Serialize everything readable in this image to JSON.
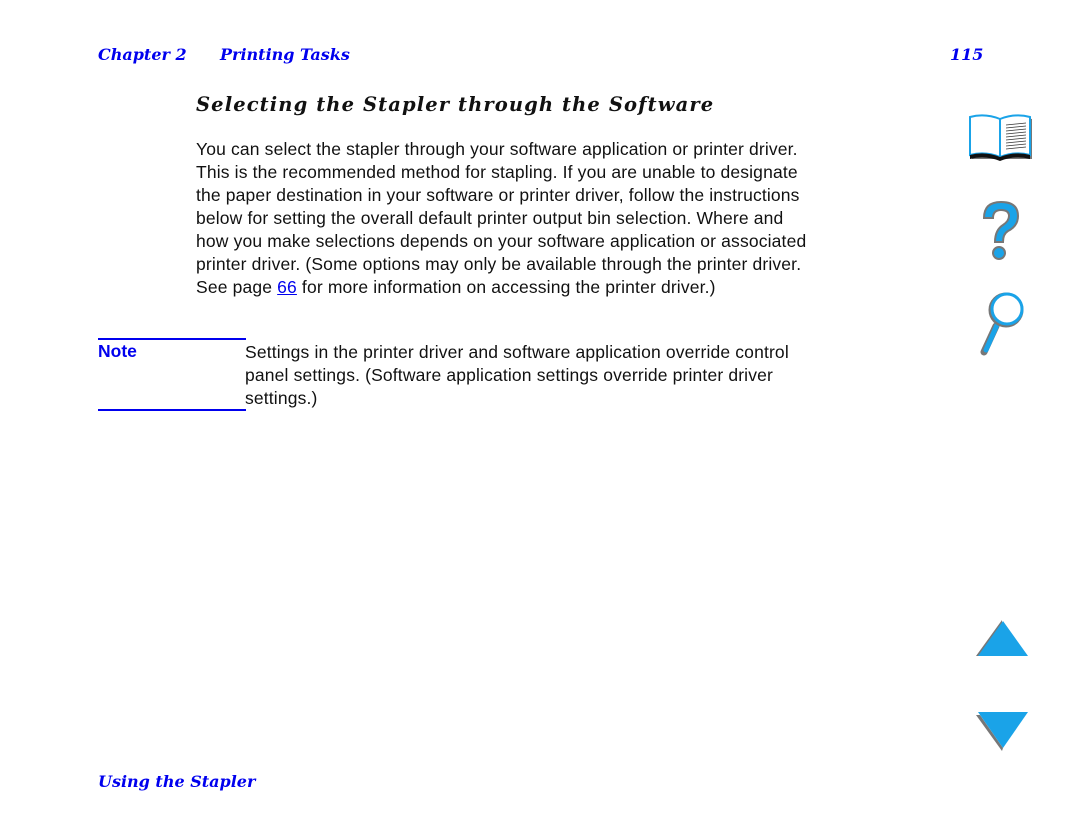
{
  "header": {
    "chapter": "Chapter 2",
    "section": "Printing Tasks",
    "page_number": "115"
  },
  "heading": "Selecting the Stapler through the Software",
  "body": {
    "lines": [
      "You can select the stapler through your software application or printer driver.",
      "This is the recommended method for stapling. If you are unable to designate",
      "the paper destination in your software or printer driver, follow the instructions",
      "below for setting the overall default printer output bin selection. Where and",
      "how you make selections depends on your software application or associated",
      "printer driver. (Some options may only be available through the printer driver."
    ],
    "last_line_prefix": "See page ",
    "link_text": "66",
    "last_line_suffix": " for more information on accessing the printer driver.)"
  },
  "note": {
    "label": "Note",
    "lines": [
      "Settings in the printer driver and software application override control",
      "panel settings. (Software application settings override printer driver",
      "settings.)"
    ]
  },
  "footer": {
    "section_title": "Using the Stapler"
  },
  "nav_icons": [
    {
      "name": "contents",
      "icon": "book-icon"
    },
    {
      "name": "help",
      "icon": "question-mark-icon"
    },
    {
      "name": "index",
      "icon": "magnifier-icon"
    },
    {
      "name": "previous-page",
      "icon": "arrow-up-icon"
    },
    {
      "name": "next-page",
      "icon": "arrow-down-icon"
    }
  ],
  "colors": {
    "accent_blue": "#0000ee",
    "icon_blue": "#1aa3e8",
    "icon_shadow": "#777777"
  }
}
